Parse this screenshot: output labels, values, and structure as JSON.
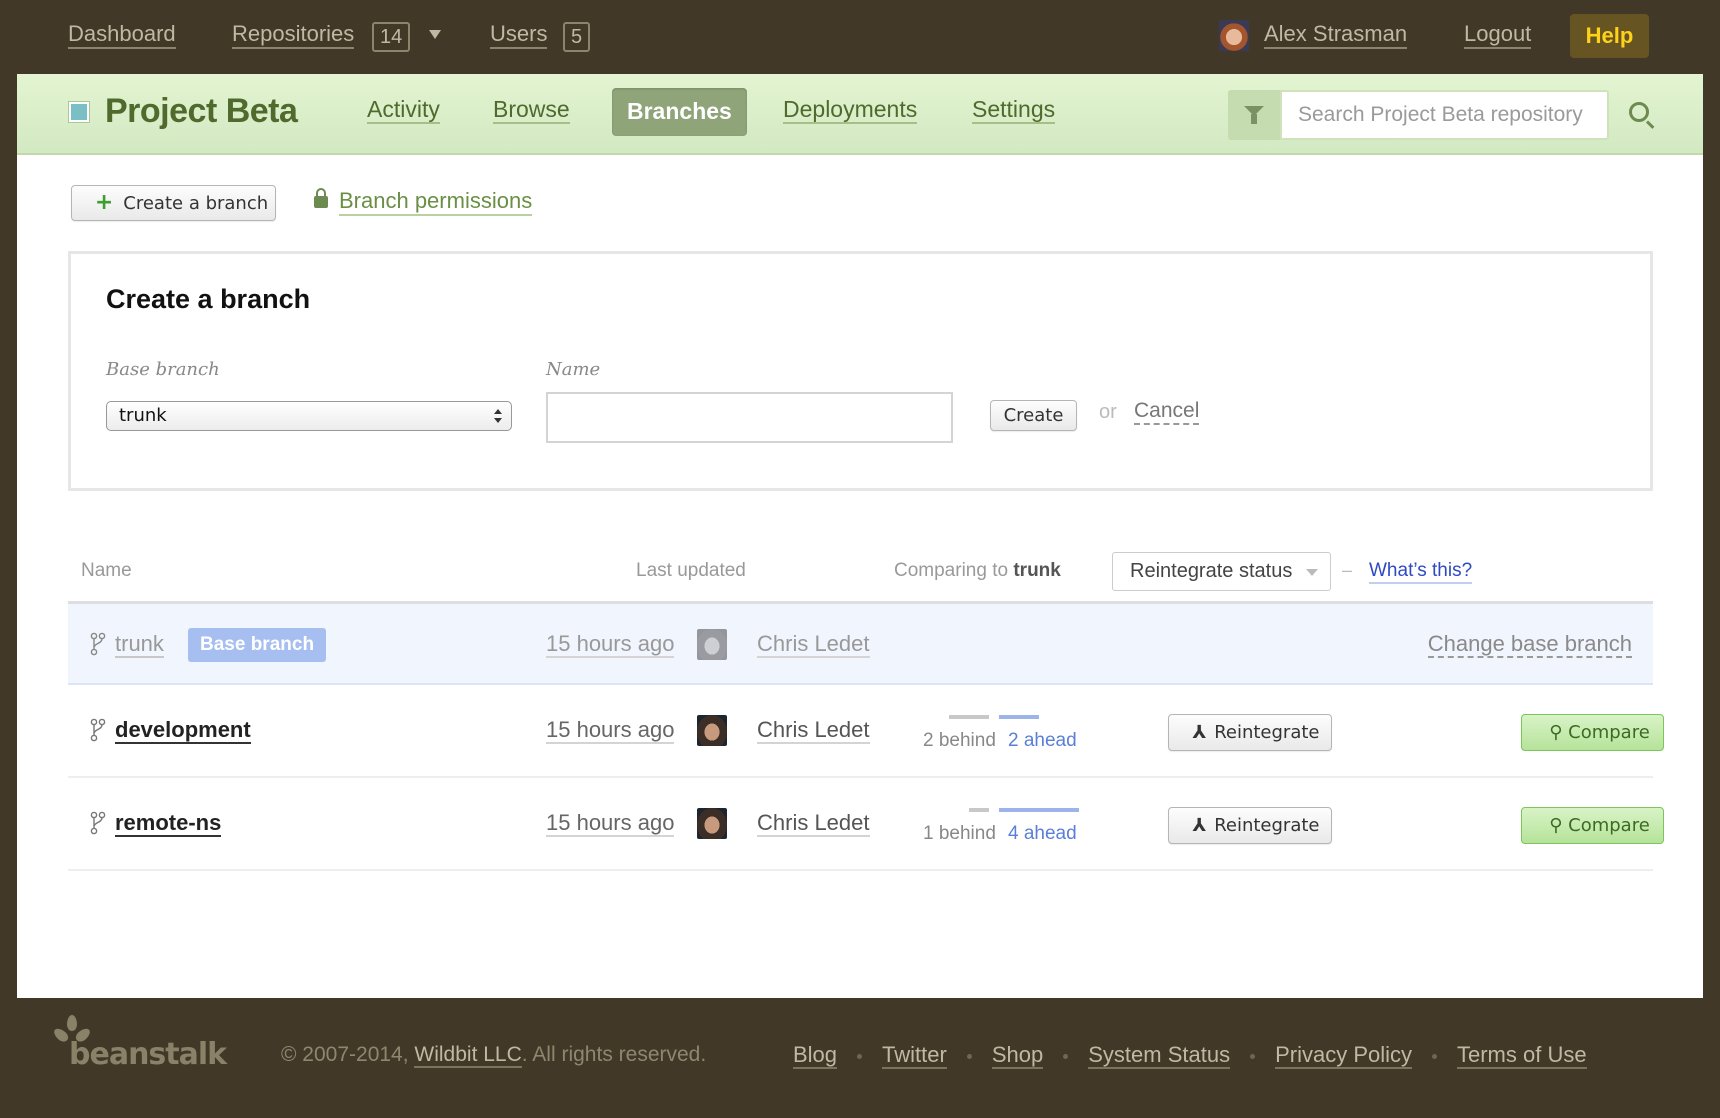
{
  "topbar": {
    "nav": [
      {
        "label": "Dashboard"
      },
      {
        "label": "Repositories",
        "count": "14"
      },
      {
        "label": "Users",
        "count": "5"
      }
    ],
    "user_name": "Alex Strasman",
    "logout_label": "Logout",
    "help_label": "Help"
  },
  "project": {
    "title": "Project Beta",
    "color": "#79bfc3",
    "tabs": [
      {
        "label": "Activity",
        "active": false
      },
      {
        "label": "Browse",
        "active": false
      },
      {
        "label": "Branches",
        "active": true
      },
      {
        "label": "Deployments",
        "active": false
      },
      {
        "label": "Settings",
        "active": false
      }
    ],
    "search_placeholder": "Search Project Beta repository"
  },
  "toolbar": {
    "create_branch_label": "Create a branch",
    "branch_permissions_label": "Branch permissions"
  },
  "create_panel": {
    "title": "Create a branch",
    "base_branch_label": "Base branch",
    "base_branch_value": "trunk",
    "name_label": "Name",
    "name_value": "",
    "create_label": "Create",
    "or_label": "or",
    "cancel_label": "Cancel"
  },
  "table": {
    "headers": {
      "name": "Name",
      "last_updated": "Last updated",
      "comparing_prefix": "Comparing to",
      "comparing_branch": "trunk",
      "status_select": "Reintegrate status",
      "dash": "–",
      "whats_this": "What’s this?"
    },
    "base_row": {
      "name": "trunk",
      "badge": "Base branch",
      "updated": "15 hours ago",
      "author": "Chris Ledet",
      "change_label": "Change base branch"
    },
    "rows": [
      {
        "name": "development",
        "updated": "15 hours ago",
        "author": "Chris Ledet",
        "behind": 2,
        "ahead": 2,
        "behind_label": "2 behind",
        "ahead_label": "2 ahead",
        "reintegrate_label": "Reintegrate",
        "compare_label": "Compare"
      },
      {
        "name": "remote-ns",
        "updated": "15 hours ago",
        "author": "Chris Ledet",
        "behind": 1,
        "ahead": 4,
        "behind_label": "1 behind",
        "ahead_label": "4 ahead",
        "reintegrate_label": "Reintegrate",
        "compare_label": "Compare"
      }
    ]
  },
  "footer": {
    "logo_text": "beanstalk",
    "copyright_prefix": "© 2007-2014, ",
    "company": "Wildbit LLC",
    "copyright_suffix": ". All rights reserved.",
    "links": [
      "Blog",
      "Twitter",
      "Shop",
      "System Status",
      "Privacy Policy",
      "Terms of Use"
    ]
  }
}
